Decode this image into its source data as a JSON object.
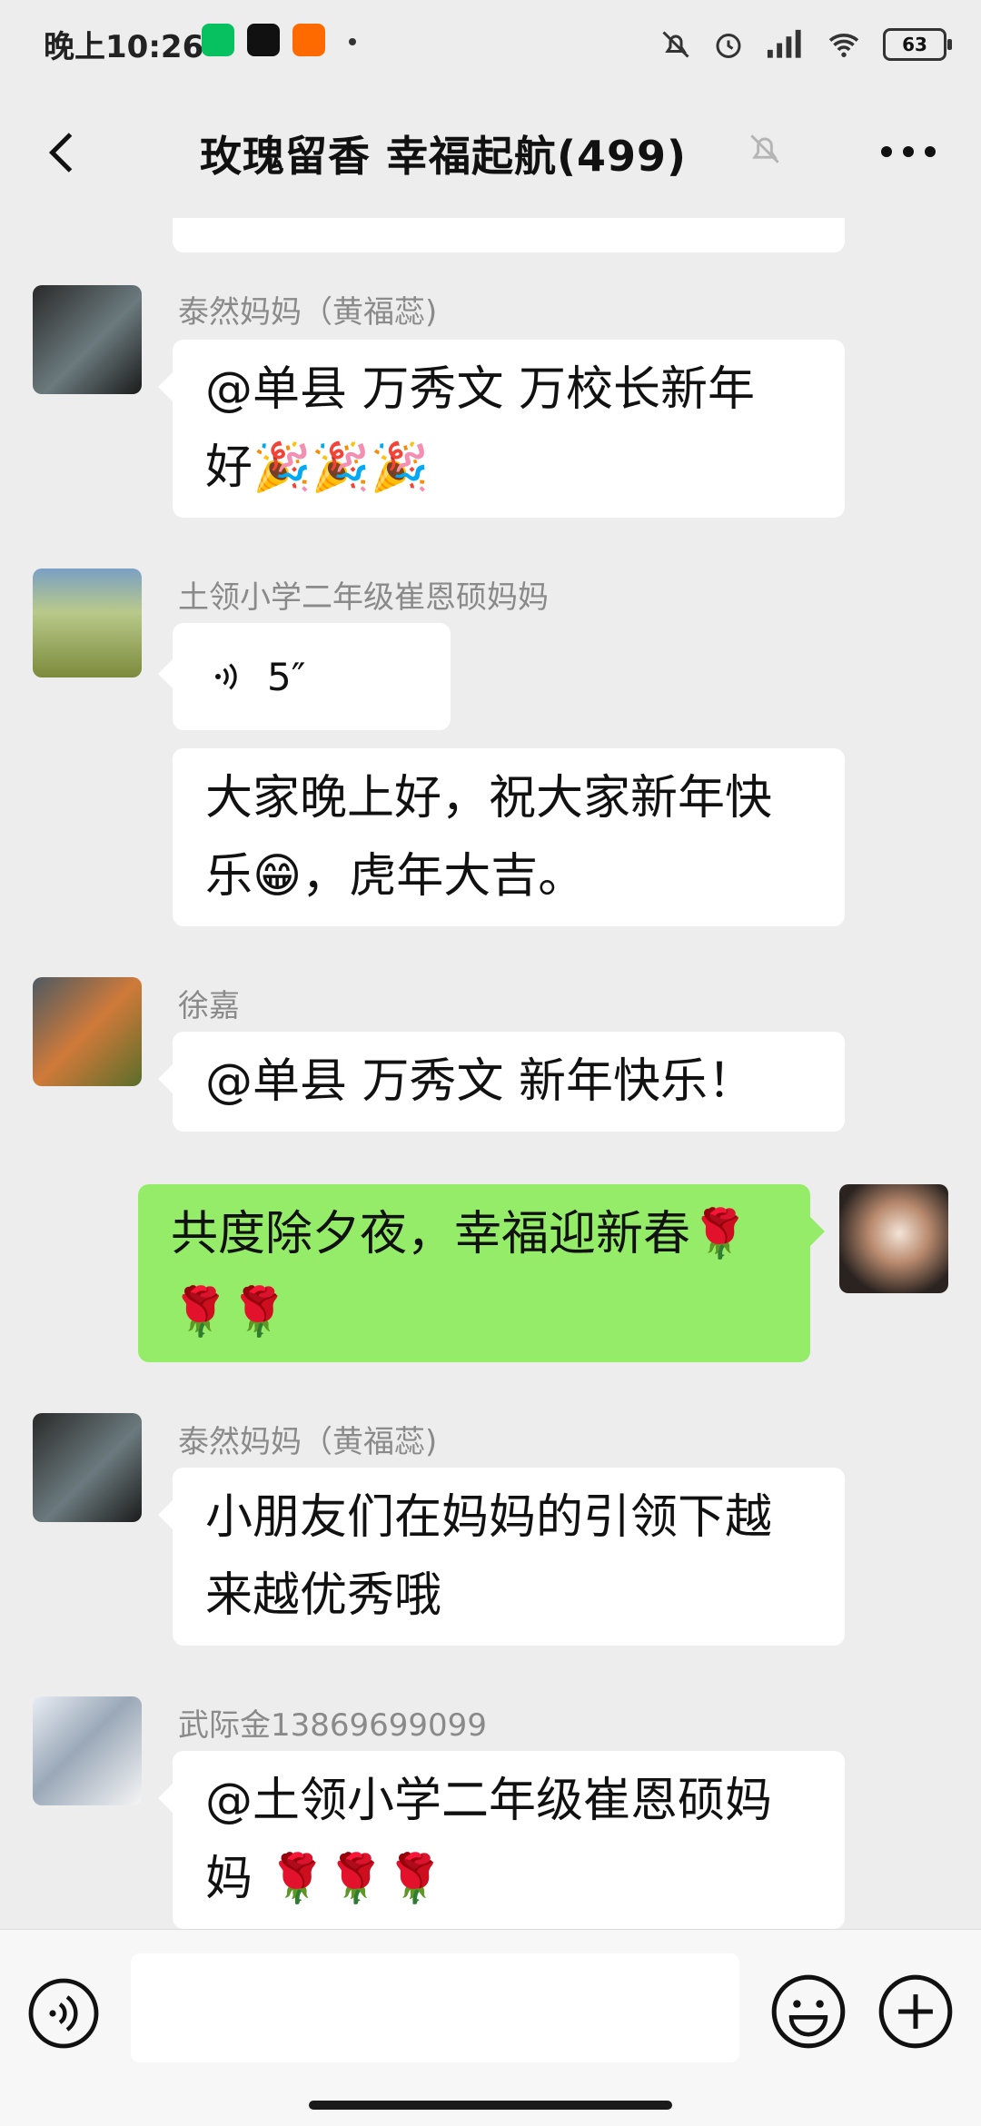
{
  "status_bar": {
    "time": "晚上10:26",
    "battery": "63",
    "icons": [
      "wechat-icon",
      "tiktok-icon",
      "taobao-icon",
      "mute-icon",
      "alarm-icon",
      "signal-icon",
      "wifi-icon",
      "battery-icon"
    ]
  },
  "header": {
    "title": "玫瑰留香  幸福起航(499)",
    "icons": [
      "back-icon",
      "bell-mute-icon",
      "more-icon"
    ]
  },
  "messages": [
    {
      "sender": "泰然妈妈（黄福蕊)",
      "lines": [
        "@单县 万秀文  万校长新年",
        "好🎉🎉🎉"
      ]
    },
    {
      "sender": "土领小学二年级崔恩硕妈妈",
      "voice_duration": "5″",
      "lines": [
        "大家晚上好，祝大家新年快",
        "乐😁，虎年大吉。"
      ]
    },
    {
      "sender": "徐嘉",
      "lines": [
        "@单县 万秀文  新年快乐！"
      ]
    },
    {
      "sender": "",
      "lines": [
        "共度除夕夜，幸福迎新春🌹",
        "🌹🌹"
      ]
    },
    {
      "sender": "泰然妈妈（黄福蕊)",
      "lines": [
        "小朋友们在妈妈的引领下越",
        "来越优秀哦"
      ]
    },
    {
      "sender": "武际金13869699099",
      "lines": [
        "@土领小学二年级崔恩硕妈",
        "妈  🌹🌹🌹"
      ]
    }
  ],
  "input": {
    "value": "",
    "placeholder": ""
  },
  "colors": {
    "background": "#ededed",
    "my_bubble": "#95ec69",
    "other_bubble": "#ffffff"
  }
}
